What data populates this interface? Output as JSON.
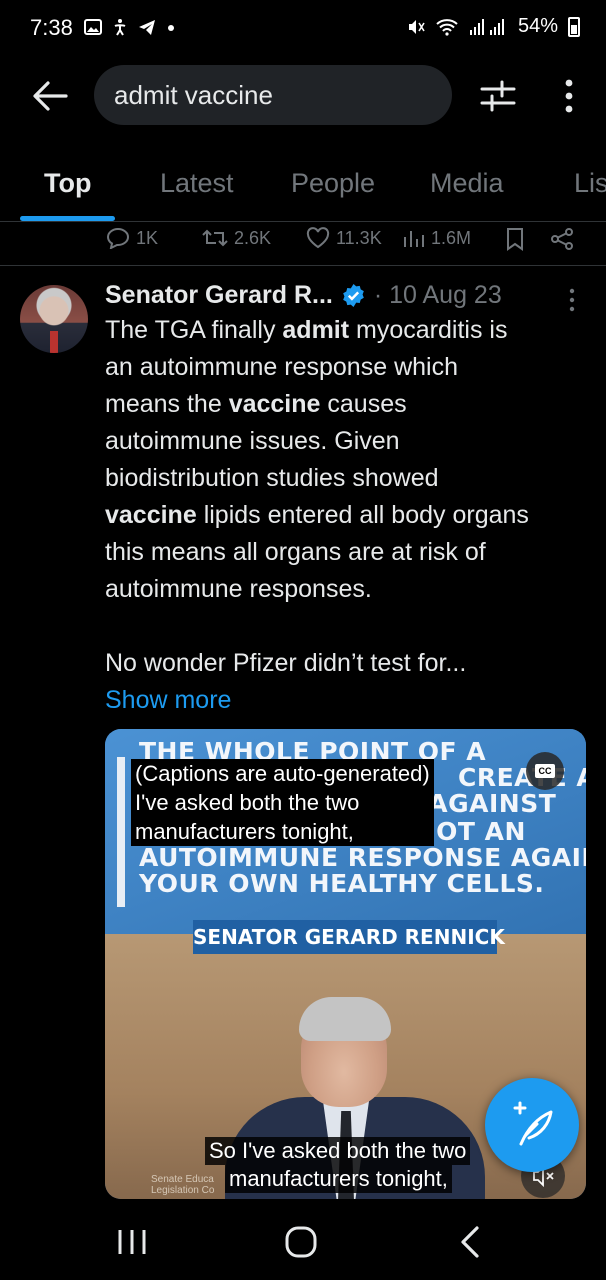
{
  "status_bar": {
    "time": "7:38",
    "battery": "54%"
  },
  "search": {
    "query": "admit vaccine"
  },
  "tabs": [
    {
      "label": "Top",
      "active": true
    },
    {
      "label": "Latest",
      "active": false
    },
    {
      "label": "People",
      "active": false
    },
    {
      "label": "Media",
      "active": false
    },
    {
      "label": "Lis",
      "active": false
    }
  ],
  "previous_post_actions": {
    "replies": "1K",
    "reposts": "2.6K",
    "likes": "11.3K",
    "views": "1.6M"
  },
  "post": {
    "author": "Senator Gerard R...",
    "date": "· 10 Aug 23",
    "text_segments": {
      "l1a": "The TGA finally ",
      "l1b": "admit",
      "l1c": " myocarditis is",
      "l2": "an autoimmune response which",
      "l3a": "means the ",
      "l3b": "vaccine",
      "l3c": " causes",
      "l4": "autoimmune issues. Given",
      "l5": "biodistribution studies showed",
      "l6a": "vaccine",
      "l6b": " lipids entered all body organs",
      "l7": "this means all organs are at risk of",
      "l8": "autoimmune responses.",
      "l9": "No wonder Pfizer didn’t test for..."
    },
    "show_more": "Show more"
  },
  "media": {
    "banner_lines": [
      "THE WHOLE POINT OF A",
      "CREATE AN",
      "SE AGAINST",
      "S, NOT AN",
      "AUTOIMMUNE RESPONSE AGAINST",
      "YOUR OWN HEALTHY CELLS."
    ],
    "name_plate": "SENATOR GERARD RENNICK",
    "auto_caption": [
      "(Captions are auto-generated)",
      "I've asked both the two",
      "manufacturers tonight,"
    ],
    "cc_label": "CC",
    "subtitle": [
      "So I've asked both the two",
      "manufacturers tonight,"
    ],
    "watermark": [
      "Senate Educa",
      "Legislation Co"
    ]
  },
  "colors": {
    "accent": "#1d9bf0",
    "background": "#000000",
    "muted": "#71767b"
  }
}
